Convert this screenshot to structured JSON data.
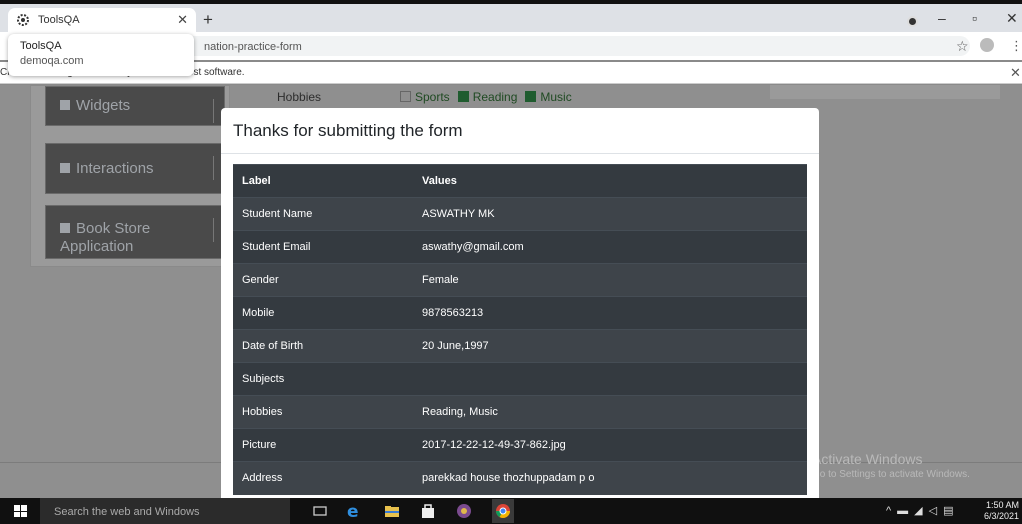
{
  "browser": {
    "tab_title": "ToolsQA",
    "hover_card": {
      "title": "ToolsQA",
      "domain": "demoqa.com"
    },
    "url_fragment": "nation-practice-form",
    "infobar": "Chrome is being controlled by automated test software.",
    "window_controls": {
      "minimize": "–",
      "maximize": "▫",
      "close": "✕"
    }
  },
  "page": {
    "sidebar_groups": [
      "Widgets",
      "Interactions",
      "Book Store Application"
    ],
    "hobbies": {
      "label": "Hobbies",
      "options": [
        {
          "label": "Sports",
          "checked": false
        },
        {
          "label": "Reading",
          "checked": true
        },
        {
          "label": "Music",
          "checked": true
        }
      ]
    },
    "watermark": {
      "line1": "Activate Windows",
      "line2": "Go to Settings to activate Windows."
    }
  },
  "modal": {
    "title": "Thanks for submitting the form",
    "columns": [
      "Label",
      "Values"
    ],
    "rows": [
      [
        "Student Name",
        "ASWATHY MK"
      ],
      [
        "Student Email",
        "aswathy@gmail.com"
      ],
      [
        "Gender",
        "Female"
      ],
      [
        "Mobile",
        "9878563213"
      ],
      [
        "Date of Birth",
        "20 June,1997"
      ],
      [
        "Subjects",
        ""
      ],
      [
        "Hobbies",
        "Reading, Music"
      ],
      [
        "Picture",
        "2017-12-22-12-49-37-862.jpg"
      ],
      [
        "Address",
        "parekkad house thozhuppadam p o"
      ]
    ]
  },
  "taskbar": {
    "search_placeholder": "Search the web and Windows",
    "time": "1:50 AM",
    "date": "6/3/2021"
  },
  "colors": {
    "table_dark": "#343a40",
    "table_alt": "#3e444a",
    "checked_green": "#1f5c2f"
  }
}
